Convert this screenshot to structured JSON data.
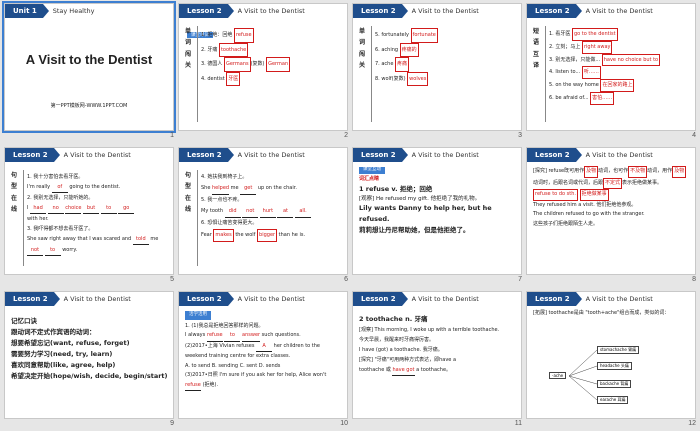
{
  "slides": [
    {
      "num": "1",
      "unit": "Unit 1",
      "unit_title": "Stay Healthy",
      "title": "A Visit to the Dentist",
      "sub": "第一PPT模板网-WWW.1PPT.COM"
    },
    {
      "num": "2",
      "lesson": "Lesson 2",
      "ltitle": "A Visit to the Dentist",
      "tag": "课堂单词",
      "vert": "单词闯关",
      "rows": [
        "1. 拒绝：回绝",
        "2. 牙痛",
        "3. 德国人",
        "4. dentist"
      ],
      "answers": [
        "refuse",
        "toothache",
        "Germans",
        "German",
        "牙医"
      ],
      "extra": "(复数)"
    },
    {
      "num": "3",
      "lesson": "Lesson 2",
      "ltitle": "A Visit to the Dentist",
      "vert": "单词闯关",
      "rows": [
        "5. fortunately",
        "6. aching",
        "7. ache",
        "8. wolf"
      ],
      "answers": [
        "fortunate",
        "疼痛的",
        "疼痛",
        "wolves"
      ],
      "extra": "(复数)"
    },
    {
      "num": "4",
      "lesson": "Lesson 2",
      "ltitle": "A Visit to the Dentist",
      "vert": "短语互译",
      "rows": [
        "1. 看牙医",
        "2. 立刻；马上",
        "3. 别无选择，只能做...",
        "4. listen to...",
        "5. on the way home",
        "6. be afraid of..."
      ],
      "answers": [
        "go to the dentist",
        "right away",
        "have no choice but to",
        "听……",
        "在回家的路上",
        "害怕……"
      ]
    },
    {
      "num": "5",
      "lesson": "Lesson 2",
      "ltitle": "A Visit to the Dentist",
      "vert": "句型在线",
      "lines": [
        "1. 我十分害怕去看牙医。",
        "I'm really",
        "of",
        "going",
        "to the dentist.",
        "2. 我别无选择，只能听她的。",
        "I",
        "had",
        "no",
        "choice",
        "but",
        "to",
        "go",
        "with her.",
        "3. 我吓得都不想去看牙医了。",
        "She saw right away that I was scared and",
        "told",
        "me",
        "not",
        "to",
        "worry."
      ]
    },
    {
      "num": "6",
      "lesson": "Lesson 2",
      "ltitle": "A Visit to the Dentist",
      "vert": "句型在线",
      "lines": [
        "4. 她扶我到椅子上。",
        "She",
        "helped",
        "me",
        "get",
        "up on the chair.",
        "5. 我一点也不疼。",
        "My tooth",
        "did",
        "not",
        "hurt",
        "at",
        "all.",
        "6. 恐惧让痛苦变得更大。",
        "Fear",
        "makes",
        "the wolf",
        "bigger",
        "than he is."
      ]
    },
    {
      "num": "7",
      "lesson": "Lesson 2",
      "ltitle": "A Visit to the Dentist",
      "tag": "课堂互动",
      "section": "词汇点睛",
      "item": "1  refuse v. 拒绝；回绝",
      "lines": [
        "[观察] He refused my gift. 他拒绝了我的礼物。",
        "Lily wants Danny to help her, but he refused.",
        "莉莉想让丹尼帮助她，但是他拒绝了。"
      ]
    },
    {
      "num": "8",
      "lesson": "Lesson 2",
      "ltitle": "A Visit to the Dentist",
      "lines": [
        "[探究] refuse既可用作",
        "及物",
        "动词，也可作",
        "不及物",
        "动词，用作",
        "及物",
        "动词时，后跟名词或代词，后跟",
        "不定式",
        "表示拒绝做某事。",
        "refuse to do sth.",
        "拒绝做某事",
        "They refused him a visit. 他们拒绝他参观。",
        "The children refused to go with the stranger.",
        "这些孩子们拒绝跟陌生人走。"
      ]
    },
    {
      "num": "9",
      "lesson": "Lesson 2",
      "ltitle": "A Visit to the Dentist",
      "lines": [
        "记忆口诀",
        "跟动词不定式作宾语的动词：",
        "想要希望忘记(want, refuse, forget)",
        "需要努力学习(need, try, learn)",
        "喜欢同意帮助(like, agree, help)",
        "希望决定开始(hope/wish, decide, begin/start)"
      ]
    },
    {
      "num": "10",
      "lesson": "Lesson 2",
      "ltitle": "A Visit to the Dentist",
      "tag": "活学活用",
      "lines": [
        "1. (1)我总是拒绝回答那样的问题。",
        "I always",
        "refuse",
        "to",
        "answer",
        "such questions.",
        "(2)2017•上海 Vivian refuses",
        "A",
        "her children to the weekend training centre for extra classes.",
        "A. to send   B. sending   C. sent   D. sends",
        "(3)2017•日照 I'm sure if you ask her for help, Alice won't",
        "refuse",
        "(拒绝)."
      ]
    },
    {
      "num": "11",
      "lesson": "Lesson 2",
      "ltitle": "A Visit to the Dentist",
      "item": "2  toothache n. 牙痛",
      "lines": [
        "[观察] This morning, I woke up with a terrible toothache.",
        "今天早晨，我醒来时牙痛得厉害。",
        "I have (got) a toothache. 我牙痛。",
        "[探究] \"牙痛\"可用两种方式表达，即have a",
        "toothache 或",
        "have got",
        "a toothache。"
      ]
    },
    {
      "num": "12",
      "lesson": "Lesson 2",
      "ltitle": "A Visit to the Dentist",
      "lines": [
        "[拓展] toothache是由 \"tooth+ache\"组合而成，类似的词："
      ],
      "tree": [
        "-ache",
        "stomachache 胃痛",
        "headache 头痛",
        "backache 背痛",
        "earache 耳痛"
      ]
    }
  ]
}
